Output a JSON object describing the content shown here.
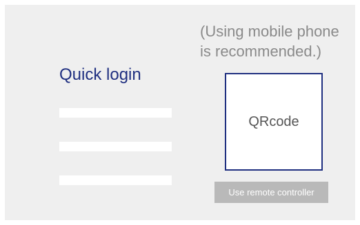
{
  "login": {
    "title": "Quick login",
    "fields": [
      {
        "value": ""
      },
      {
        "value": ""
      },
      {
        "value": ""
      }
    ]
  },
  "qr": {
    "hint_lines": [
      "(Using mobile phone",
      "is recommended.)"
    ],
    "label": "QRcode"
  },
  "actions": {
    "remote_label": "Use remote controller"
  },
  "colors": {
    "accent": "#1f2f80",
    "panel": "#efefef",
    "button": "#b9b9b9",
    "hint_text": "#8a8a8a"
  }
}
